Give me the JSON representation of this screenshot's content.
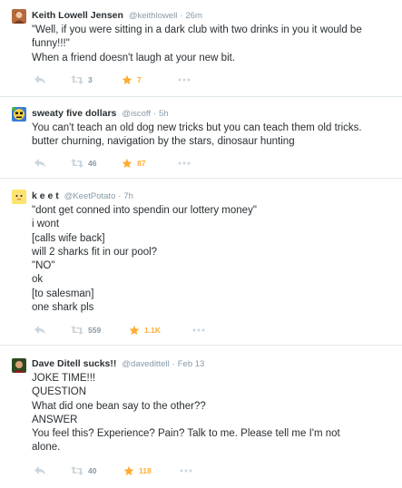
{
  "colors": {
    "text": "#292f33",
    "meta": "#8899a6",
    "favorite": "#ffac33",
    "divider": "#e1e8ed",
    "icon": "#ccd6dd"
  },
  "tweets": [
    {
      "name": "Keith Lowell Jensen",
      "handle": "@keithlowell",
      "sep": "·",
      "time": "26m",
      "lines": [
        "\"Well, if you were sitting in a dark club with two drinks in you it would be",
        "funny!!!\"",
        "When a friend doesn't laugh at your new bit."
      ],
      "retweets": "3",
      "favorites": "7",
      "reply_icon": "reply-icon",
      "retweet_icon": "retweet-icon",
      "favorite_icon": "star-icon",
      "more_icon": "more-dots-icon"
    },
    {
      "name": "sweaty five dollars",
      "handle": "@iscoff",
      "sep": "·",
      "time": "5h",
      "lines": [
        "You can't teach an old dog new tricks but you can teach them old tricks.",
        "butter churning, navigation by the stars, dinosaur hunting"
      ],
      "retweets": "46",
      "favorites": "87",
      "reply_icon": "reply-icon",
      "retweet_icon": "retweet-icon",
      "favorite_icon": "star-icon",
      "more_icon": "more-dots-icon"
    },
    {
      "name": "k e e t",
      "handle": "@KeetPotato",
      "sep": "·",
      "time": "7h",
      "lines": [
        "\"dont get conned into spendin our lottery money\"",
        "i wont",
        "[calls wife back]",
        "will 2 sharks fit in our pool?",
        "\"NO\"",
        "ok",
        "[to salesman]",
        "one shark pls"
      ],
      "retweets": "559",
      "favorites": "1.1K",
      "reply_icon": "reply-icon",
      "retweet_icon": "retweet-icon",
      "favorite_icon": "star-icon",
      "more_icon": "more-dots-icon"
    },
    {
      "name": "Dave Ditell sucks!!",
      "handle": "@davedittell",
      "sep": "·",
      "time": "Feb 13",
      "lines": [
        "JOKE TIME!!!",
        "QUESTION",
        "What did one bean say to the other??",
        "ANSWER",
        "You feel this? Experience? Pain? Talk to me. Please tell me I'm not",
        "alone."
      ],
      "retweets": "40",
      "favorites": "118",
      "reply_icon": "reply-icon",
      "retweet_icon": "retweet-icon",
      "favorite_icon": "star-icon",
      "more_icon": "more-dots-icon"
    }
  ]
}
